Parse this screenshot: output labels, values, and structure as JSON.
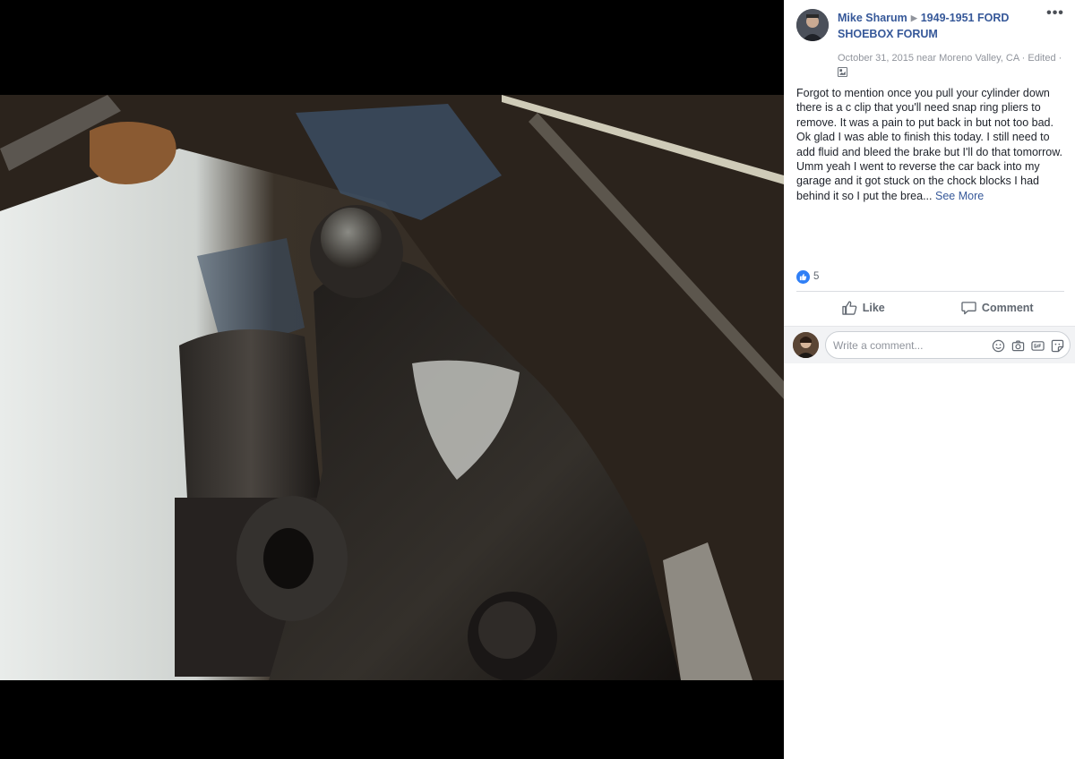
{
  "post": {
    "author": "Mike Sharum",
    "group": "1949-1951 FORD SHOEBOX FORUM",
    "meta": "October 31, 2015 near Moreno Valley, CA · Edited ·",
    "text": "Forgot to mention once you pull your cylinder down there is a c clip that you'll need snap ring pliers to remove. It was a pain to put back in but not too bad. Ok glad I was able to finish this today. I still need to add fluid and bleed the brake but I'll do that tomorrow. Umm yeah I went to reverse the car back into my garage and it got stuck on the chock blocks I had behind it so I put the brea...",
    "see_more": "See More",
    "reaction_count": "5"
  },
  "actions": {
    "like": "Like",
    "comment": "Comment"
  },
  "composer": {
    "placeholder": "Write a comment..."
  },
  "icons": [
    "more-options-icon",
    "globe-icon",
    "like-reaction-icon",
    "like-thumb-icon",
    "comment-bubble-icon",
    "emoji-icon",
    "camera-icon",
    "gif-icon",
    "sticker-icon"
  ],
  "colors": {
    "link": "#365899",
    "like_blue": "#2f7ff6",
    "text": "#1d2129",
    "muted": "#90949c"
  }
}
